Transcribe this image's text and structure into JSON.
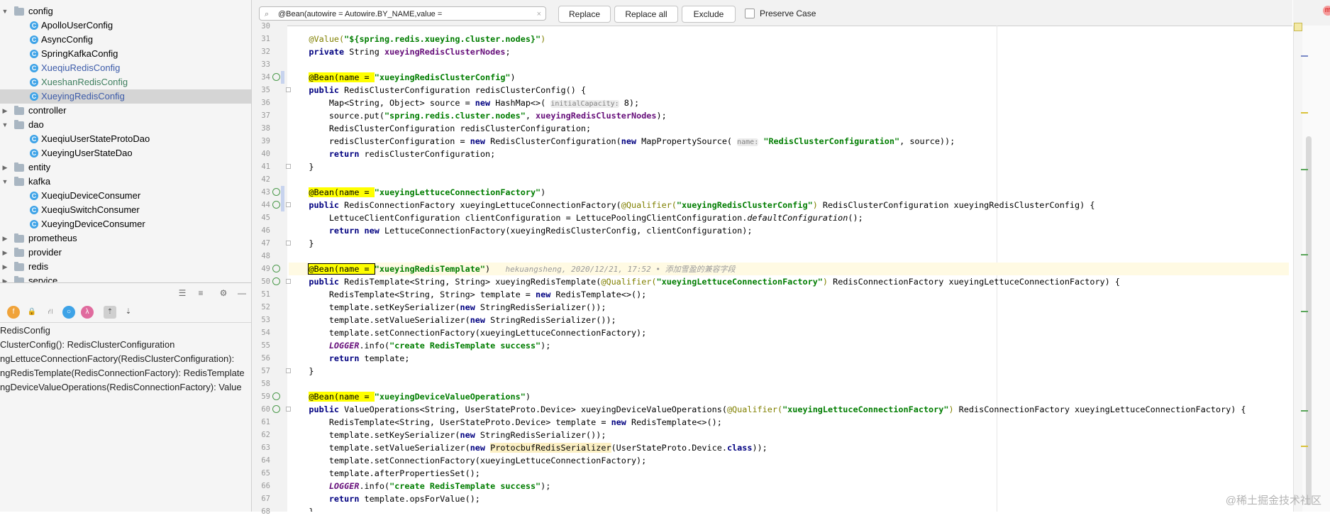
{
  "project_tree": {
    "items": [
      {
        "label": "config",
        "type": "folder",
        "expanded": true
      },
      {
        "label": "ApolloUserConfig",
        "type": "class"
      },
      {
        "label": "AsyncConfig",
        "type": "class"
      },
      {
        "label": "SpringKafkaConfig",
        "type": "class"
      },
      {
        "label": "XueqiuRedisConfig",
        "type": "class",
        "color": "#3c5ba9"
      },
      {
        "label": "XueshanRedisConfig",
        "type": "class",
        "color": "#3f7f5f"
      },
      {
        "label": "XueyingRedisConfig",
        "type": "class",
        "color": "#3c5ba9",
        "selected": true
      },
      {
        "label": "controller",
        "type": "folder",
        "expanded": false
      },
      {
        "label": "dao",
        "type": "folder",
        "expanded": true
      },
      {
        "label": "XueqiuUserStateProtoDao",
        "type": "class"
      },
      {
        "label": "XueyingUserStateDao",
        "type": "class"
      },
      {
        "label": "entity",
        "type": "folder",
        "expanded": false
      },
      {
        "label": "kafka",
        "type": "folder",
        "expanded": true
      },
      {
        "label": "XueqiuDeviceConsumer",
        "type": "class"
      },
      {
        "label": "XueqiuSwitchConsumer",
        "type": "class"
      },
      {
        "label": "XueyingDeviceConsumer",
        "type": "class"
      },
      {
        "label": "prometheus",
        "type": "folder",
        "expanded": false
      },
      {
        "label": "provider",
        "type": "folder",
        "expanded": false
      },
      {
        "label": "redis",
        "type": "folder",
        "expanded": false
      },
      {
        "label": "service",
        "type": "folder",
        "expanded": false
      }
    ]
  },
  "structure": {
    "items": [
      "RedisConfig",
      "ClusterConfig(): RedisClusterConfiguration",
      "ngLettuceConnectionFactory(RedisClusterConfiguration):",
      "ngRedisTemplate(RedisConnectionFactory): RedisTemplate",
      "ngDeviceValueOperations(RedisConnectionFactory): Value"
    ]
  },
  "findbar": {
    "query": "@Bean(autowire = Autowire.BY_NAME,value =",
    "replace_label": "Replace",
    "replace_all_label": "Replace all",
    "exclude_label": "Exclude",
    "preserve_case_label": "Preserve Case"
  },
  "editor": {
    "line_numbers": [
      "30",
      "31",
      "32",
      "33",
      "34",
      "35",
      "36",
      "37",
      "38",
      "39",
      "40",
      "41",
      "42",
      "43",
      "44",
      "45",
      "46",
      "47",
      "48",
      "49",
      "50",
      "51",
      "52",
      "53",
      "54",
      "55",
      "56",
      "57",
      "58",
      "59",
      "60",
      "61",
      "62",
      "63",
      "64",
      "65",
      "66",
      "67",
      "68"
    ],
    "blame": "hekuangsheng, 2020/12/21, 17:52 • 添加雪盈的兼容字段",
    "hints": {
      "initial_capacity": "initialCapacity:",
      "name": "name:"
    }
  },
  "watermark": "@稀土掘金技术社区",
  "user_badge": "m"
}
